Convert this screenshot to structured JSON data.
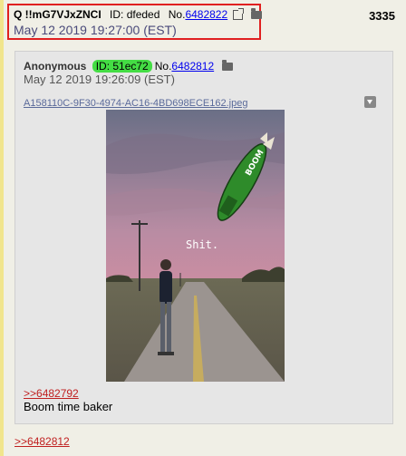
{
  "post": {
    "tripcode": "Q !!mG7VJxZNCI",
    "id_label": "ID: dfeded",
    "no_label": "No.",
    "number": "6482822",
    "date": "May 12 2019 19:27:00 (EST)",
    "reply_count": "3335",
    "backlink": ">>6482812"
  },
  "reply": {
    "name": "Anonymous",
    "id_badge": "ID: 51ec72",
    "no_label": "No.",
    "number": "6482812",
    "date": "May 12 2019 19:26:09 (EST)",
    "filename": "A158110C-9F30-4974-AC16-4BD698ECE162.jpeg",
    "image_caption": "Shit.",
    "bomb_text": "BOOM",
    "quote": ">>6482792",
    "message": "Boom time baker"
  },
  "colors": {
    "highlight_border": "#e02020",
    "id_badge": "#44dd44",
    "quote": "#c02020",
    "link": "#0000ee"
  },
  "icons": [
    "external-link-icon",
    "folder-icon",
    "download-icon"
  ]
}
